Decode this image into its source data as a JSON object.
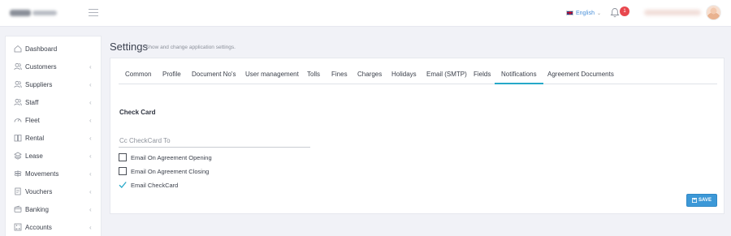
{
  "header": {
    "language": "English",
    "notification_count": "1"
  },
  "sidebar": {
    "items": [
      {
        "label": "Dashboard",
        "icon": "home-icon",
        "has_children": false
      },
      {
        "label": "Customers",
        "icon": "users-icon",
        "has_children": true
      },
      {
        "label": "Suppliers",
        "icon": "users-icon",
        "has_children": true
      },
      {
        "label": "Staff",
        "icon": "users-icon",
        "has_children": true
      },
      {
        "label": "Fleet",
        "icon": "speedometer-icon",
        "has_children": true
      },
      {
        "label": "Rental",
        "icon": "book-icon",
        "has_children": true
      },
      {
        "label": "Lease",
        "icon": "layers-icon",
        "has_children": true
      },
      {
        "label": "Movements",
        "icon": "signpost-icon",
        "has_children": true
      },
      {
        "label": "Vouchers",
        "icon": "document-icon",
        "has_children": true
      },
      {
        "label": "Banking",
        "icon": "wallet-icon",
        "has_children": true
      },
      {
        "label": "Accounts",
        "icon": "calculator-icon",
        "has_children": true
      }
    ],
    "chevron": "‹"
  },
  "page": {
    "title": "Settings",
    "subtitle": "Show and change application settings."
  },
  "tabs": [
    {
      "label": "Common",
      "active": false
    },
    {
      "label": "Profile",
      "active": false
    },
    {
      "label": "Document No's",
      "active": false
    },
    {
      "label": "User management",
      "active": false
    },
    {
      "label": "Tolls",
      "active": false
    },
    {
      "label": "Fines",
      "active": false
    },
    {
      "label": "Charges",
      "active": false
    },
    {
      "label": "Holidays",
      "active": false
    },
    {
      "label": "Email (SMTP)",
      "active": false
    },
    {
      "label": "Fields",
      "active": false
    },
    {
      "label": "Notifications",
      "active": true
    },
    {
      "label": "Agreement Documents",
      "active": false
    }
  ],
  "notifications": {
    "section_title": "Check Card",
    "cc_field": {
      "placeholder": "Cc CheckCard To",
      "value": ""
    },
    "options": [
      {
        "label": "Email On Agreement Opening",
        "checked": false
      },
      {
        "label": "Email On Agreement Closing",
        "checked": false
      },
      {
        "label": "Email CheckCard",
        "checked": true
      }
    ],
    "save_label": "SAVE"
  },
  "colors": {
    "accent": "#26a8c9",
    "save_button": "#3c98d7",
    "badge": "#e8474e",
    "link": "#4a90d9"
  }
}
